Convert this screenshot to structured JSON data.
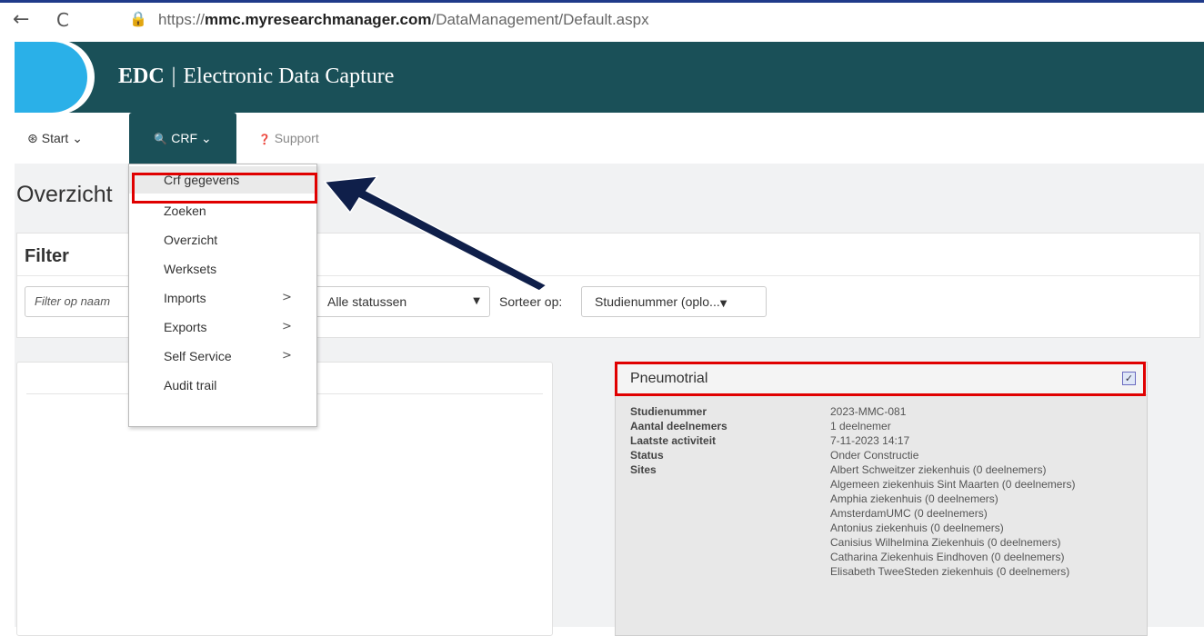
{
  "browser": {
    "url_prefix": "https://",
    "url_domain": "mmc.myresearchmanager.com",
    "url_path": "/DataManagement/Default.aspx",
    "back_icon": "←",
    "reload_icon": "C",
    "lock_icon": "🔒"
  },
  "header": {
    "brand": "EDC",
    "separator": "|",
    "title": "Electronic Data Capture"
  },
  "nav": {
    "start_icon": "⊛",
    "start_label": "Start",
    "start_caret": "⌄",
    "crf_icon": "🔍",
    "crf_label": "CRF",
    "crf_caret": "⌄",
    "support_icon": "❓",
    "support_label": "Support"
  },
  "dropdown": {
    "items": [
      {
        "label": "Crf gegevens",
        "arrow": ""
      },
      {
        "label": "Zoeken",
        "arrow": ""
      },
      {
        "label": "Overzicht",
        "arrow": ""
      },
      {
        "label": "Werksets",
        "arrow": ""
      },
      {
        "label": "Imports",
        "arrow": ">"
      },
      {
        "label": "Exports",
        "arrow": ">"
      },
      {
        "label": "Self Service",
        "arrow": ">"
      },
      {
        "label": "Audit trail",
        "arrow": ""
      }
    ]
  },
  "page": {
    "title": "Overzicht",
    "filter_heading": "Filter",
    "filter_placeholder": "Filter op naam",
    "status_value": "Alle statussen",
    "status_caret": "▼",
    "sort_label": "Sorteer op:",
    "sort_value": "Studienummer (oplo...",
    "sort_caret": "▼"
  },
  "study": {
    "name": "Pneumotrial",
    "checked_mark": "✓",
    "fields": [
      {
        "label": "Studienummer",
        "value": "2023-MMC-081"
      },
      {
        "label": "Aantal deelnemers",
        "value": "1 deelnemer"
      },
      {
        "label": "Laatste activiteit",
        "value": "7-11-2023 14:17"
      },
      {
        "label": "Status",
        "value": "Onder Constructie"
      },
      {
        "label": "Sites",
        "value": "Albert Schweitzer ziekenhuis (0 deelnemers)"
      }
    ],
    "more_sites": [
      "Algemeen ziekenhuis Sint Maarten (0 deelnemers)",
      "Amphia ziekenhuis (0 deelnemers)",
      "AmsterdamUMC (0 deelnemers)",
      "Antonius ziekenhuis (0 deelnemers)",
      "Canisius Wilhelmina Ziekenhuis (0 deelnemers)",
      "Catharina Ziekenhuis Eindhoven (0 deelnemers)",
      "Elisabeth TweeSteden ziekenhuis (0 deelnemers)"
    ]
  },
  "colors": {
    "header_teal": "#1a5058",
    "accent_blue": "#2ab0e8",
    "highlight_red": "#e00000",
    "arrow_navy": "#0f1f4a"
  }
}
